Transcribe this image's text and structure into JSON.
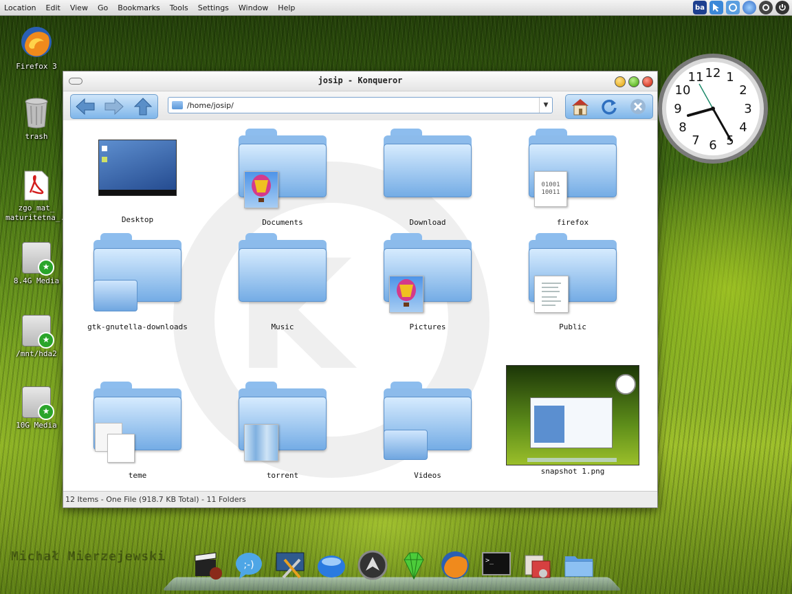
{
  "menubar": {
    "items": [
      "Location",
      "Edit",
      "View",
      "Go",
      "Bookmarks",
      "Tools",
      "Settings",
      "Window",
      "Help"
    ],
    "tray": [
      "ba-indicator-icon",
      "cursor-icon",
      "klipper-icon",
      "network-icon",
      "volume-icon",
      "logout-icon"
    ],
    "tray_text": "ba"
  },
  "desktop": {
    "icons": [
      {
        "label": "Firefox 3",
        "icon": "firefox-icon"
      },
      {
        "label": "trash",
        "icon": "trash-icon"
      },
      {
        "label": "zgo_mat_ maturitetna_..",
        "icon": "pdf-icon"
      },
      {
        "label": "8.4G Media",
        "icon": "hdd-icon"
      },
      {
        "label": "/mnt/hda2",
        "icon": "hdd-icon"
      },
      {
        "label": "10G Media",
        "icon": "hdd-icon"
      }
    ],
    "credit": "Michał Mierzejewski"
  },
  "window": {
    "title": "josip - Konqueror",
    "location": "/home/josip/",
    "status": "12 Items - One File (918.7 KB Total) - 11 Folders",
    "items": [
      {
        "label": "Desktop",
        "kind": "desktop-preview"
      },
      {
        "label": "Documents",
        "kind": "folder",
        "emblem": "balloon"
      },
      {
        "label": "Download",
        "kind": "folder"
      },
      {
        "label": "firefox",
        "kind": "folder",
        "emblem": "binary"
      },
      {
        "label": "gtk-gnutella-downloads",
        "kind": "folder",
        "emblem": "folder"
      },
      {
        "label": "Music",
        "kind": "folder"
      },
      {
        "label": "Pictures",
        "kind": "folder",
        "emblem": "balloon"
      },
      {
        "label": "Public",
        "kind": "folder",
        "emblem": "document"
      },
      {
        "label": "teme",
        "kind": "folder",
        "emblem": "pages"
      },
      {
        "label": "torrent",
        "kind": "folder",
        "emblem": "waterfall"
      },
      {
        "label": "Videos",
        "kind": "folder",
        "emblem": "folder"
      },
      {
        "label": "snapshot 1.png",
        "kind": "image"
      }
    ],
    "emblem_text": {
      "binary": "01001 10011"
    }
  },
  "clock": {
    "numbers": [
      "12",
      "1",
      "2",
      "3",
      "4",
      "5",
      "6",
      "7",
      "8",
      "9",
      "10",
      "11"
    ],
    "time": "8:27"
  },
  "dock": {
    "items": [
      "video-editor-icon",
      "chat-icon",
      "system-settings-icon",
      "browser-orb-icon",
      "amarok-icon",
      "gem-icon",
      "firefox-dock-icon",
      "terminal-icon",
      "package-manager-icon",
      "file-manager-icon"
    ]
  },
  "colors": {
    "folder": "#74ace5",
    "accent": "#6b9ccc",
    "menubar": "#e4e4e4"
  }
}
